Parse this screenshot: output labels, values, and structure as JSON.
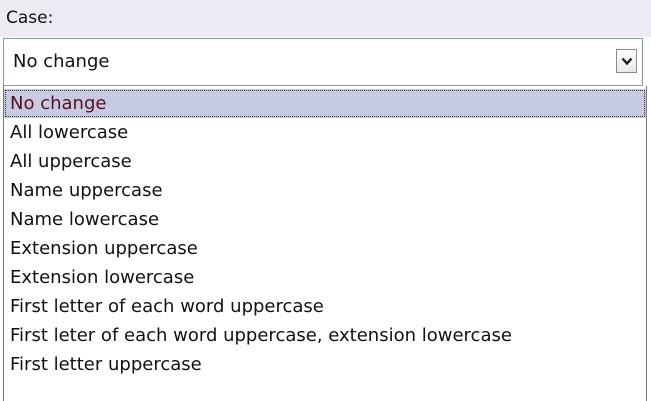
{
  "case_field": {
    "label": "Case:",
    "selected_value": "No change",
    "dropdown_icon": "chevron-down-icon",
    "options": [
      "No change",
      "All lowercase",
      "All uppercase",
      "Name uppercase",
      "Name lowercase",
      "Extension uppercase",
      "Extension lowercase",
      "First letter of each word uppercase",
      "First leter of each word uppercase, extension lowercase",
      "First letter uppercase"
    ],
    "highlighted_option": "No change"
  },
  "colors": {
    "header_band": "#ecebf3",
    "field_border": "#7f9db9",
    "highlight_background": "#c6cbe1",
    "highlight_text": "#5a0f1c"
  }
}
